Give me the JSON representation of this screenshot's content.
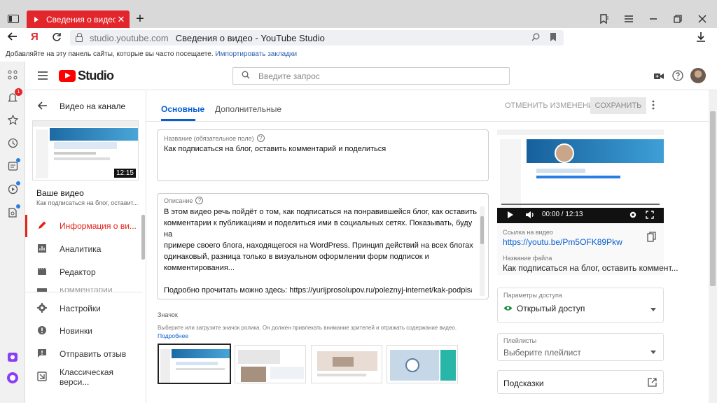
{
  "browser": {
    "tab_title": "Сведения о видео - YouTube Studio",
    "new_tab": "+",
    "tab_close": "✕",
    "url_domain": "studio.youtube.com",
    "url_title": "Сведения о видео - YouTube Studio",
    "ya_logo": "Я",
    "bookmarks_text": "Добавляйте на эту панель сайты, которые вы часто посещаете.",
    "bookmarks_link": "Импортировать закладки"
  },
  "studio": {
    "logo_text": "Studio",
    "search_placeholder": "Введите запрос"
  },
  "sidebar": {
    "back_label": "Видео на канале",
    "thumb_duration": "12:15",
    "your_video_label": "Ваше видео",
    "video_title_short": "Как подписаться на блог, оставит...",
    "items": [
      {
        "label": "Информация о ви...",
        "active": true
      },
      {
        "label": "Аналитика"
      },
      {
        "label": "Редактор"
      },
      {
        "label": "Комментарии"
      },
      {
        "label": "Настройки"
      },
      {
        "label": "Новинки"
      },
      {
        "label": "Отправить отзыв"
      },
      {
        "label": "Классическая верси..."
      }
    ]
  },
  "main": {
    "tab_basic": "Основные",
    "tab_advanced": "Дополнительные",
    "undo_label": "ОТМЕНИТЬ ИЗМЕНЕНИЯ",
    "save_label": "СОХРАНИТЬ",
    "title_field_label": "Название (обязательное поле)",
    "title_value": "Как подписаться на блог, оставить комментарий и поделиться",
    "desc_field_label": "Описание",
    "desc_line1": "В этом видео речь пойдёт о том, как подписаться на понравившейся блог, как оставить",
    "desc_line2": "комментарии к публикациям и поделиться ими в социальных сетях. Показывать, буду на",
    "desc_line3": "примере своего блога, находящегося на WordPress. Принцип действий на всех блогах",
    "desc_line4": "одинаковый, разница только в визуальном оформлении форм подписок и",
    "desc_line5": "комментирования...",
    "desc_line6": "Подробно прочитать можно здесь: https://yurijprosolupov.ru/poleznyj-internet/kak-podpisatsya-",
    "thumbnail_label": "Значок",
    "thumbnail_hint": "Выберите или загрузите значок ролика. Он должен привлекать внимание зрителей и отражать содержание видео.",
    "thumbnail_more": "Подробнее"
  },
  "right": {
    "player_time": "00:00 / 12:13",
    "link_label": "Ссылка на видео",
    "link_value": "https://youtu.be/Pm5OFK89Pkw",
    "file_label": "Название файла",
    "file_value": "Как подписаться на блог, оставить коммент...",
    "access_label": "Параметры доступа",
    "access_value": "Открытый доступ",
    "playlist_label": "Плейлисты",
    "playlist_value": "Выберите плейлист",
    "hints_label": "Подсказки"
  },
  "panel": {
    "notif_count": "1"
  },
  "colors": {
    "accent": "#e62117",
    "link": "#065fd4",
    "tab_red": "#e2262b"
  }
}
